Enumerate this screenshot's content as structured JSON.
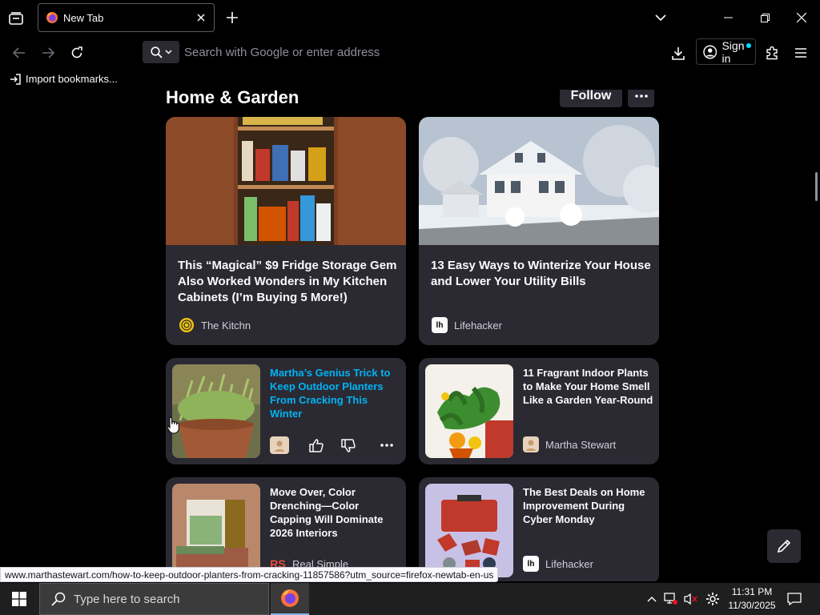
{
  "browser": {
    "tab": {
      "title": "New Tab"
    },
    "urlbar": {
      "placeholder": "Search with Google or enter address"
    },
    "signin_label": "Sign in",
    "bookmarks": {
      "import_label": "Import bookmarks..."
    }
  },
  "section": {
    "title": "Home & Garden",
    "follow_label": "Follow"
  },
  "cards": [
    {
      "title": "This “Magical” $9 Fridge Storage Gem Also Worked Wonders in My Kitchen Cabinets (I’m Buying 5 More!)",
      "source": "The Kitchn"
    },
    {
      "title": "13 Easy Ways to Winterize Your House and Lower Your Utility Bills",
      "source": "Lifehacker"
    },
    {
      "title": "Martha’s Genius Trick to Keep Outdoor Planters From Cracking This Winter",
      "source": ""
    },
    {
      "title": "11 Fragrant Indoor Plants to Make Your Home Smell Like a Garden Year-Round",
      "source": "Martha Stewart"
    },
    {
      "title": "Move Over, Color Drenching—Color Capping Will Dominate 2026 Interiors",
      "source": "Real Simple"
    },
    {
      "title": "The Best Deals on Home Improvement During Cyber Monday",
      "source": "Lifehacker"
    }
  ],
  "status_url": "www.marthastewart.com/how-to-keep-outdoor-planters-from-cracking-11857586?utm_source=firefox-newtab-en-us",
  "taskbar": {
    "search_placeholder": "Type here to search",
    "time": "11:31 PM",
    "date": "11/30/2025"
  },
  "colors": {
    "background": "#000000",
    "card": "#2b2a33",
    "link": "#00b3f4",
    "text": "#fbfbfe"
  }
}
